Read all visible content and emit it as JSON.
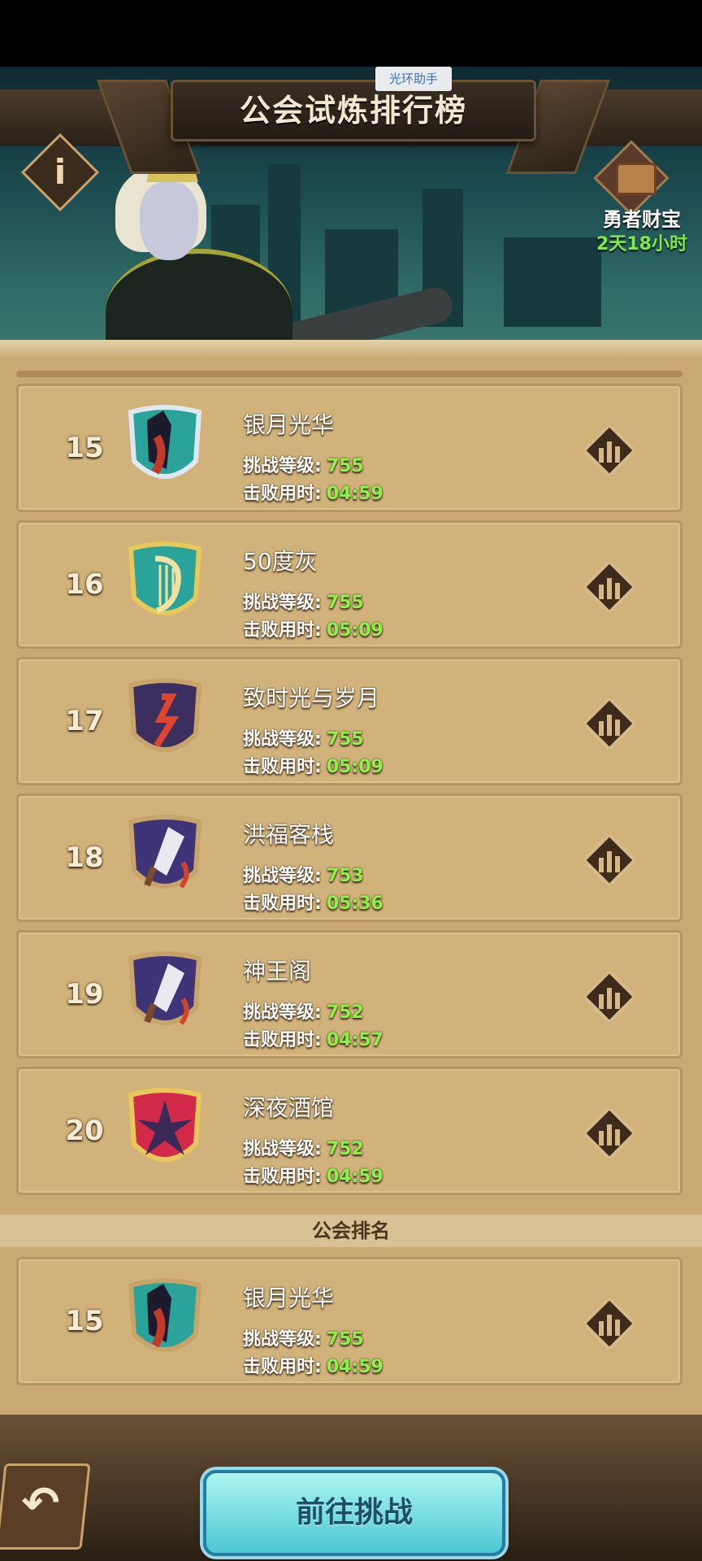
{
  "header": {
    "helper_badge": "光环助手",
    "title": "公会试炼排行榜",
    "info_glyph": "i"
  },
  "treasure": {
    "label": "勇者财宝",
    "time": "2天18小时"
  },
  "stat_labels": {
    "level": "挑战等级:",
    "time": "击败用时:"
  },
  "rows": [
    {
      "rank": "15",
      "name": "银月光华",
      "level": "755",
      "time": "04:59"
    },
    {
      "rank": "16",
      "name": "50度灰",
      "level": "755",
      "time": "05:09"
    },
    {
      "rank": "17",
      "name": "致时光与岁月",
      "level": "755",
      "time": "05:09"
    },
    {
      "rank": "18",
      "name": "洪福客栈",
      "level": "753",
      "time": "05:36"
    },
    {
      "rank": "19",
      "name": "神王阁",
      "level": "752",
      "time": "04:57"
    },
    {
      "rank": "20",
      "name": "深夜酒馆",
      "level": "752",
      "time": "04:59"
    }
  ],
  "guild_section": {
    "label": "公会排名",
    "rank": "15",
    "name": "银月光华",
    "level": "755",
    "time": "04:59"
  },
  "footer": {
    "back_glyph": "↶",
    "go_label": "前往挑战"
  },
  "colors": {
    "value_green": "#8ef04a",
    "panel_tan": "#c9a872",
    "row_tan": "#d2b27b",
    "button_cyan": "#4cc7d3"
  }
}
